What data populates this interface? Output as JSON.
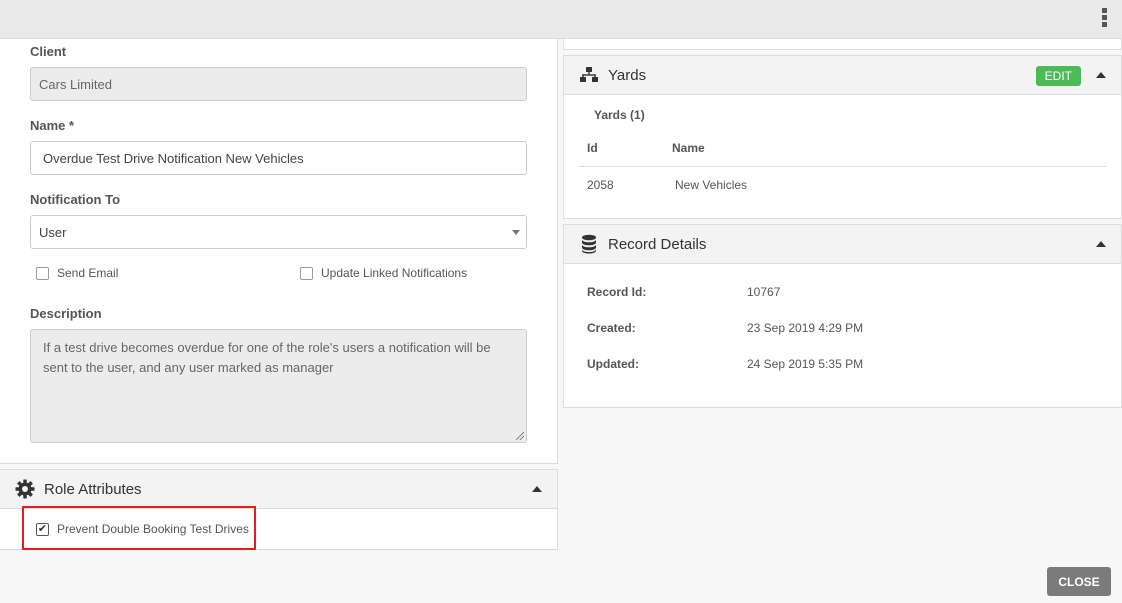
{
  "form": {
    "client_label": "Client",
    "client_value": "Cars Limited",
    "name_label": "Name *",
    "name_value": "Overdue Test Drive Notification New Vehicles",
    "notification_to_label": "Notification To",
    "notification_to_value": "User",
    "send_email_label": "Send Email",
    "update_linked_label": "Update Linked Notifications",
    "description_label": "Description",
    "description_value": "If a test drive becomes overdue for one of the role's users a notification will be sent to the user, and any user marked as manager"
  },
  "role_attributes": {
    "title": "Role Attributes",
    "prevent_double_booking_label": "Prevent Double Booking Test Drives",
    "prevent_double_booking_checked": true
  },
  "yards": {
    "title": "Yards",
    "edit_label": "EDIT",
    "subtitle": "Yards (1)",
    "columns": [
      "Id",
      "Name"
    ],
    "rows": [
      {
        "id": "2058",
        "name": "New Vehicles"
      }
    ]
  },
  "record_details": {
    "title": "Record Details",
    "record_id_label": "Record Id:",
    "record_id_value": "10767",
    "created_label": "Created:",
    "created_value": "23 Sep 2019 4:29 PM",
    "updated_label": "Updated:",
    "updated_value": "24 Sep 2019 5:35 PM"
  },
  "footer": {
    "close_label": "CLOSE"
  },
  "icons": {
    "menu": "kebab-menu-icon",
    "role": "gear-icon",
    "yards": "network-icon",
    "record": "database-icon"
  },
  "colors": {
    "edit_button": "#4cbb55",
    "close_button": "#7b7b7b",
    "highlight": "#e02020"
  }
}
